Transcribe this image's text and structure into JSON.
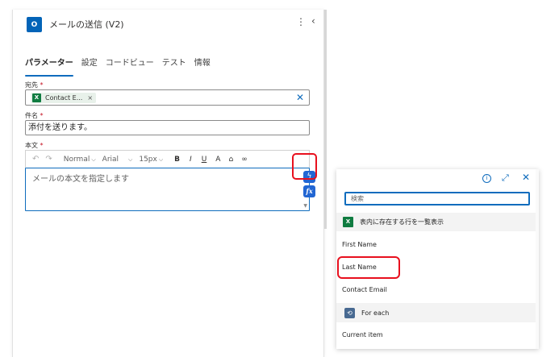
{
  "action": {
    "icon_text": "O",
    "title": "メールの送信 (V2)",
    "more_icon": "⋮",
    "collapse_icon": "‹"
  },
  "tabs": [
    {
      "label": "パラメーター",
      "active": true
    },
    {
      "label": "設定",
      "active": false
    },
    {
      "label": "コードビュー",
      "active": false
    },
    {
      "label": "テスト",
      "active": false
    },
    {
      "label": "情報",
      "active": false
    }
  ],
  "fields": {
    "to": {
      "label": "宛先",
      "required": "*",
      "token_icon": "X",
      "token_label": "Contact E...",
      "token_remove": "×",
      "clear_icon": "✕"
    },
    "subject": {
      "label": "件名",
      "required": "*",
      "value": "添付を送ります。"
    },
    "body": {
      "label": "本文",
      "required": "*",
      "placeholder": "メールの本文を指定します",
      "toolbar": {
        "undo": "↶",
        "redo": "↷",
        "style": "Normal",
        "font": "Arial",
        "size": "15px",
        "bold": "B",
        "italic": "I",
        "underline": "U",
        "font_color": "A",
        "highlight": "⌂",
        "link": "∞",
        "caret": "⌵"
      },
      "scroll_arrow": "▼"
    },
    "dynamic_content_icon": "ϟ",
    "expression_icon": "fx"
  },
  "flyout": {
    "info_icon": "i",
    "expand_icon": "⤢",
    "close_icon": "✕",
    "search_placeholder": "検索",
    "group_excel": {
      "icon": "X",
      "label": "表内に存在する行を一覧表示",
      "items": [
        "First Name",
        "Last Name",
        "Contact Email"
      ]
    },
    "group_foreach": {
      "icon": "⟲",
      "label": "For each",
      "items": [
        "Current item"
      ]
    }
  },
  "colors": {
    "accent": "#0f6cbd",
    "highlight_ring": "#e8101e",
    "excel": "#107c41",
    "outlook": "#0364b8",
    "loop": "#486991"
  }
}
